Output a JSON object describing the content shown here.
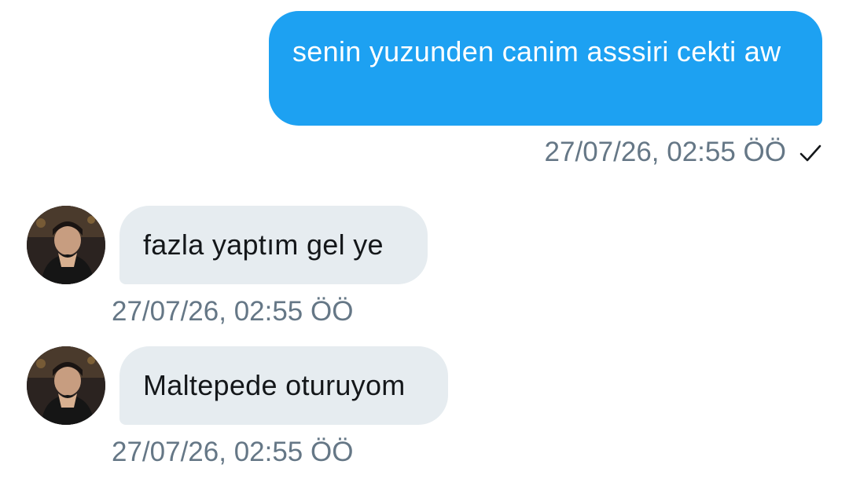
{
  "messages": [
    {
      "direction": "outgoing",
      "text": "senin yuzunden canim asssiri cekti aw",
      "timestamp": "27/07/26, 02:55 ÖÖ",
      "status_icon": "check-icon"
    },
    {
      "direction": "incoming",
      "text": "fazla yaptım gel ye",
      "timestamp": "27/07/26, 02:55 ÖÖ",
      "avatar_icon": "avatar"
    },
    {
      "direction": "incoming",
      "text": "Maltepede oturuyom",
      "timestamp": "27/07/26, 02:55 ÖÖ",
      "avatar_icon": "avatar"
    }
  ],
  "colors": {
    "outgoing_bubble": "#1da1f2",
    "incoming_bubble": "#e6ecf0",
    "timestamp_text": "#657786",
    "incoming_text": "#14171a"
  }
}
